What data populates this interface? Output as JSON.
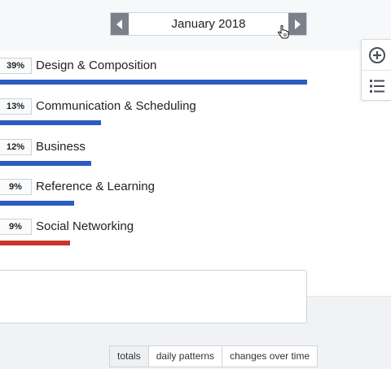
{
  "header": {
    "month": "January 2018",
    "prev_icon": "chevron-left-icon",
    "next_icon": "chevron-right-icon"
  },
  "side_tools": {
    "zoom_icon": "add-circle-icon",
    "list_icon": "list-icon"
  },
  "categories": [
    {
      "percent": "39%",
      "name": "Design & Composition",
      "bar_fraction": 0.785,
      "color": "#2a5cc2"
    },
    {
      "percent": "13%",
      "name": "Communication & Scheduling",
      "bar_fraction": 0.258,
      "color": "#2a5cc2"
    },
    {
      "percent": "12%",
      "name": "Business",
      "bar_fraction": 0.233,
      "color": "#2a5cc2"
    },
    {
      "percent": "9%",
      "name": "Reference & Learning",
      "bar_fraction": 0.19,
      "color": "#2a5cc2"
    },
    {
      "percent": "9%",
      "name": "Social Networking",
      "bar_fraction": 0.179,
      "color": "#c9372b"
    }
  ],
  "view_tabs": [
    {
      "label": "totals",
      "active": true
    },
    {
      "label": "daily patterns",
      "active": false
    },
    {
      "label": "changes over time",
      "active": false
    }
  ]
}
